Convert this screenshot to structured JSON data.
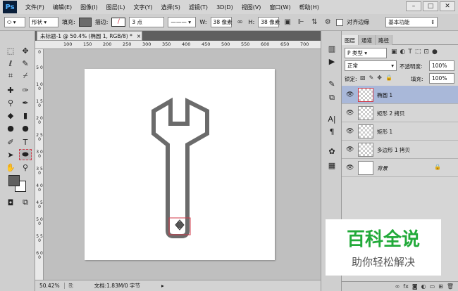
{
  "app": {
    "logo": "Ps"
  },
  "menu": [
    "文件(F)",
    "编辑(E)",
    "图像(I)",
    "图层(L)",
    "文字(Y)",
    "选择(S)",
    "滤镜(T)",
    "3D(D)",
    "视图(V)",
    "窗口(W)",
    "帮助(H)"
  ],
  "window_controls": {
    "minimize": "–",
    "restore": "□",
    "close": "✕"
  },
  "options": {
    "mode": "形状",
    "fill_label": "填充:",
    "stroke_label": "描边:",
    "stroke_width": "3 点",
    "w_label": "W:",
    "w_value": "38 像素",
    "h_label": "H:",
    "h_value": "38 像素",
    "align_edges": "对齐边缘",
    "workspace": "基本功能"
  },
  "document": {
    "tab": "未标题-1 @ 50.4% (椭圆 1, RGB/8) *",
    "tab_close": "×"
  },
  "ruler": {
    "top": [
      "100",
      "150",
      "200",
      "250",
      "300",
      "350",
      "400",
      "450",
      "500",
      "550",
      "600",
      "650",
      "700"
    ],
    "left": [
      "0",
      "5 0",
      "1 0 0",
      "1 5 0",
      "2 0 0",
      "2 5 0",
      "3 0 0",
      "3 5 0",
      "4 0 0",
      "4 5 0",
      "5 0 0",
      "5 5 0",
      "6 0 0"
    ]
  },
  "status": {
    "zoom": "50.42%",
    "doc": "文档:1.83M/0 字节"
  },
  "layers_panel": {
    "tabs": [
      "图层",
      "通道",
      "路径"
    ],
    "kind": "P 类型",
    "blend": "正常",
    "opacity_label": "不透明度:",
    "opacity_value": "100%",
    "lock_label": "锁定:",
    "fill_label": "填充:",
    "fill_value": "100%",
    "layers": [
      {
        "name": "椭圆 1",
        "selected": true
      },
      {
        "name": "矩形 2 拷贝",
        "selected": false
      },
      {
        "name": "矩形 1",
        "selected": false
      },
      {
        "name": "多边形 1 拷贝",
        "selected": false
      },
      {
        "name": "背景",
        "selected": false,
        "locked": true
      }
    ],
    "bottom_icons": [
      "link-icon",
      "fx-icon",
      "mask-icon",
      "adjustment-icon",
      "folder-icon",
      "new-layer-icon",
      "trash-icon"
    ]
  },
  "watermark": {
    "title": "百科全说",
    "subtitle": "助你轻松解决"
  },
  "colors": {
    "wrench": "#6b6b6b",
    "selection": "#d03a4a",
    "watermark_green": "#22aa3a"
  }
}
